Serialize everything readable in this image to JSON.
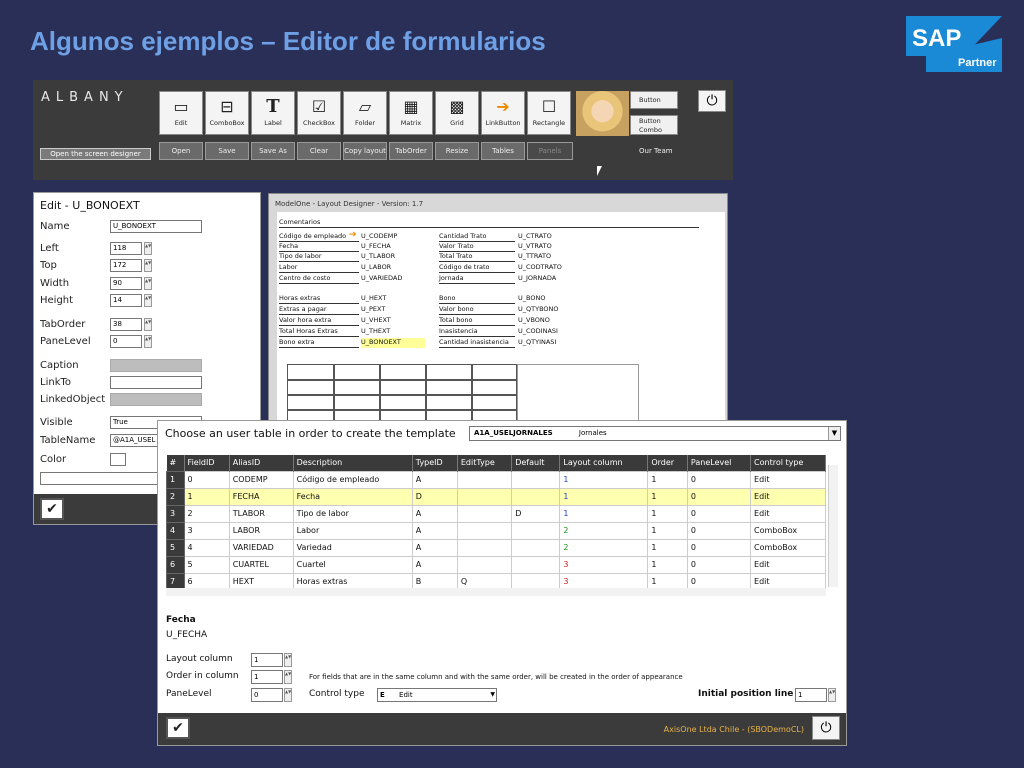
{
  "slide": {
    "title": "Algunos ejemplos – Editor de formularios"
  },
  "sap": {
    "brand": "SAP",
    "badge": "Partner",
    "color": "#1a8ad6"
  },
  "toolbar": {
    "logo": "ALBANY",
    "open_designer": "Open the screen designer",
    "tools": [
      {
        "label": "Edit",
        "icon": "edit-icon"
      },
      {
        "label": "ComboBox",
        "icon": "combobox-icon"
      },
      {
        "label": "Label",
        "icon": "label-icon"
      },
      {
        "label": "CheckBox",
        "icon": "checkbox-icon"
      },
      {
        "label": "Folder",
        "icon": "folder-icon"
      },
      {
        "label": "Matrix",
        "icon": "matrix-icon"
      },
      {
        "label": "Grid",
        "icon": "grid-icon"
      },
      {
        "label": "LinkButton",
        "icon": "arrow-icon"
      },
      {
        "label": "Rectangle",
        "icon": "rectangle-icon"
      }
    ],
    "actions": [
      "Open",
      "Save",
      "Save As",
      "Clear",
      "Copy layout",
      "TabOrder",
      "Resize",
      "Tables",
      "Panels"
    ],
    "button_label": "Button",
    "button_combo_label": "Button Combo",
    "our_team": "Our Team"
  },
  "edit": {
    "title": "Edit - U_BONOEXT",
    "props": [
      {
        "label": "Name",
        "value": "U_BONOEXT"
      },
      {
        "label": "Left",
        "value": "118"
      },
      {
        "label": "Top",
        "value": "172"
      },
      {
        "label": "Width",
        "value": "90"
      },
      {
        "label": "Height",
        "value": "14"
      },
      {
        "label": "TabOrder",
        "value": "38"
      },
      {
        "label": "PaneLevel",
        "value": "0"
      },
      {
        "label": "Caption",
        "value": ""
      },
      {
        "label": "LinkTo",
        "value": ""
      },
      {
        "label": "LinkedObject",
        "value": ""
      },
      {
        "label": "Visible",
        "value": "True"
      },
      {
        "label": "TableName",
        "value": "@A1A_USEL"
      },
      {
        "label": "Color",
        "value": ""
      }
    ]
  },
  "designer": {
    "title": "ModelOne - Layout Designer - Version: 1.7",
    "section": "Comentarios",
    "left": [
      {
        "l": "Código de empleado",
        "v": "U_CODEMP"
      },
      {
        "l": "Fecha",
        "v": "U_FECHA"
      },
      {
        "l": "Tipo de labor",
        "v": "U_TLABOR"
      },
      {
        "l": "Labor",
        "v": "U_LABOR"
      },
      {
        "l": "Centro de costo",
        "v": "U_VARIEDAD"
      },
      {
        "l": "Horas extras",
        "v": "U_HEXT"
      },
      {
        "l": "Extras a pagar",
        "v": "U_PEXT"
      },
      {
        "l": "Valor hora extra",
        "v": "U_VHEXT"
      },
      {
        "l": "Total Horas Extras",
        "v": "U_THEXT"
      },
      {
        "l": "Bono extra",
        "v": "U_BONOEXT"
      }
    ],
    "right": [
      {
        "l": "Cantidad Trato",
        "v": "U_CTRATO"
      },
      {
        "l": "Valor Trato",
        "v": "U_VTRATO"
      },
      {
        "l": "Total Trato",
        "v": "U_TTRATO"
      },
      {
        "l": "Código de trato",
        "v": "U_CODTRATO"
      },
      {
        "l": "Jornada",
        "v": "U_JORNADA"
      },
      {
        "l": "Bono",
        "v": "U_BONO"
      },
      {
        "l": "Valor bono",
        "v": "U_QTYBONO"
      },
      {
        "l": "Total bono",
        "v": "U_VBONO"
      },
      {
        "l": "Inasistencia",
        "v": "U_CODINASI"
      },
      {
        "l": "Cantidad inasistencia",
        "v": "U_QTYINASI"
      }
    ]
  },
  "template": {
    "prompt": "Choose an user table in order to create the template",
    "table_code": "A1A_USELJORNALES",
    "table_name": "Jornales",
    "columns": [
      "#",
      "FieldID",
      "AliasID",
      "Description",
      "TypeID",
      "EditType",
      "Default",
      "Layout column",
      "Order",
      "PaneLevel",
      "Control type"
    ],
    "rows": [
      [
        "1",
        "0",
        "CODEMP",
        "Código de empleado",
        "A",
        "",
        "",
        "1",
        "1",
        "0",
        "Edit"
      ],
      [
        "2",
        "1",
        "FECHA",
        "Fecha",
        "D",
        "",
        "",
        "1",
        "1",
        "0",
        "Edit"
      ],
      [
        "3",
        "2",
        "TLABOR",
        "Tipo de labor",
        "A",
        "",
        "D",
        "1",
        "1",
        "0",
        "Edit"
      ],
      [
        "4",
        "3",
        "LABOR",
        "Labor",
        "A",
        "",
        "",
        "2",
        "1",
        "0",
        "ComboBox"
      ],
      [
        "5",
        "4",
        "VARIEDAD",
        "Variedad",
        "A",
        "",
        "",
        "2",
        "1",
        "0",
        "ComboBox"
      ],
      [
        "6",
        "5",
        "CUARTEL",
        "Cuartel",
        "A",
        "",
        "",
        "3",
        "1",
        "0",
        "Edit"
      ],
      [
        "7",
        "6",
        "HEXT",
        "Horas extras",
        "B",
        "Q",
        "",
        "3",
        "1",
        "0",
        "Edit"
      ]
    ],
    "selected_name": "Fecha",
    "selected_alias": "U_FECHA",
    "layout_column_label": "Layout column",
    "layout_column": "1",
    "order_label": "Order in column",
    "order": "1",
    "panelevel_label": "PaneLevel",
    "panelevel": "0",
    "note": "For fields that are in the same column and with the same order, will be created in the order of appearance",
    "control_type_label": "Control type",
    "control_type_code": "E",
    "control_type": "Edit",
    "initial_position_label": "Initial position line",
    "initial_position": "1",
    "footer_text": "AxisOne Ltda Chile - (SBODemoCL)"
  }
}
